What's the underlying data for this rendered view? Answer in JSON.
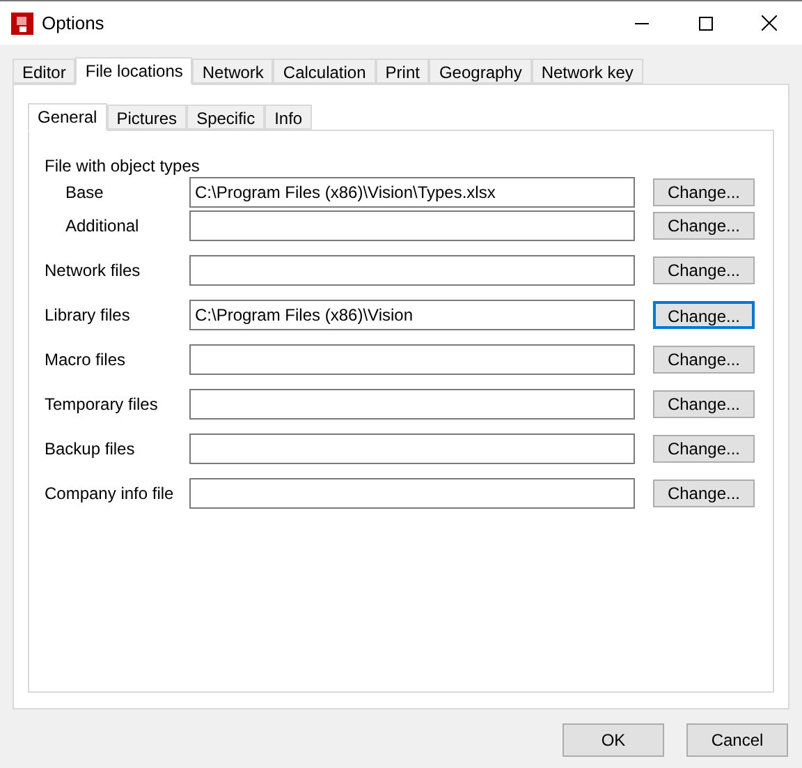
{
  "window": {
    "title": "Options"
  },
  "tabs": [
    {
      "label": "Editor",
      "selected": false
    },
    {
      "label": "File locations",
      "selected": true
    },
    {
      "label": "Network",
      "selected": false
    },
    {
      "label": "Calculation",
      "selected": false
    },
    {
      "label": "Print",
      "selected": false
    },
    {
      "label": "Geography",
      "selected": false
    },
    {
      "label": "Network key",
      "selected": false
    }
  ],
  "subtabs": [
    {
      "label": "General",
      "selected": true
    },
    {
      "label": "Pictures",
      "selected": false
    },
    {
      "label": "Specific",
      "selected": false
    },
    {
      "label": "Info",
      "selected": false
    }
  ],
  "sections": [
    {
      "label": "File with object types",
      "children": [
        {
          "label": "Base",
          "value": "C:\\Program Files (x86)\\Vision\\Types.xlsx",
          "button": "Change...",
          "focused": false
        },
        {
          "label": "Additional",
          "button": "Change...",
          "focused": false
        }
      ]
    },
    {
      "label": "Network files",
      "button": "Change...",
      "focused": false
    },
    {
      "label": "Library files",
      "value": "C:\\Program Files (x86)\\Vision",
      "button": "Change...",
      "focused": true
    },
    {
      "label": "Macro files",
      "button": "Change...",
      "focused": false
    },
    {
      "label": "Temporary files",
      "button": "Change...",
      "focused": false
    },
    {
      "label": "Backup files",
      "button": "Change...",
      "focused": false
    },
    {
      "label": "Company info file",
      "button": "Change...",
      "focused": false
    }
  ],
  "buttons": [
    "OK",
    "Cancel"
  ]
}
